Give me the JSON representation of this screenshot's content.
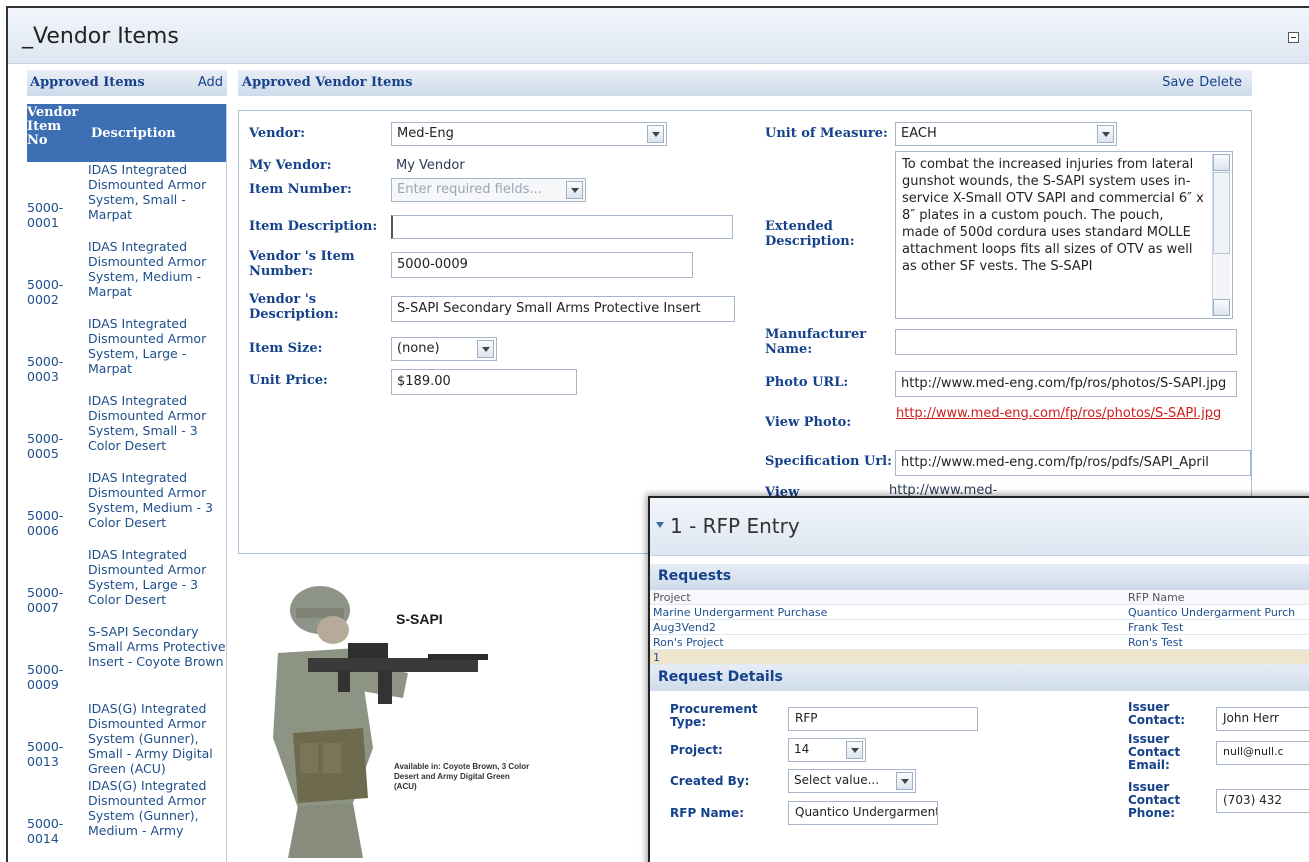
{
  "main": {
    "title": "_Vendor Items"
  },
  "approved_items": {
    "title": "Approved Items",
    "add_label": "Add",
    "col_no": "Vendor Item No",
    "col_desc": "Description",
    "rows": [
      {
        "no": "5000-0001",
        "desc": "IDAS Integrated Dismounted Armor System, Small - Marpat"
      },
      {
        "no": "5000-0002",
        "desc": "IDAS Integrated Dismounted Armor System, Medium - Marpat"
      },
      {
        "no": "5000-0003",
        "desc": "IDAS Integrated Dismounted Armor System, Large - Marpat"
      },
      {
        "no": "5000-0005",
        "desc": "IDAS Integrated Dismounted Armor System, Small - 3 Color Desert"
      },
      {
        "no": "5000-0006",
        "desc": "IDAS Integrated Dismounted Armor System, Medium - 3 Color Desert"
      },
      {
        "no": "5000-0007",
        "desc": "IDAS Integrated Dismounted Armor System, Large - 3 Color Desert"
      },
      {
        "no": "5000-0009",
        "desc": "S-SAPI Secondary Small Arms Protective Insert - Coyote Brown"
      },
      {
        "no": "5000-0013",
        "desc": "IDAS(G) Integrated Dismounted Armor System (Gunner), Small - Army Digital Green (ACU)"
      },
      {
        "no": "5000-0014",
        "desc": "IDAS(G) Integrated Dismounted Armor System (Gunner), Medium - Army"
      }
    ]
  },
  "vendor_items": {
    "title": "Approved Vendor Items",
    "save_label": "Save",
    "delete_label": "Delete",
    "vendor_label": "Vendor:",
    "vendor_value": "Med-Eng",
    "my_vendor_label": "My Vendor:",
    "my_vendor_value": "My Vendor",
    "item_number_label": "Item Number:",
    "item_number_placeholder": "Enter required fields...",
    "item_desc_label": "Item Description:",
    "item_desc_value": "",
    "vendor_item_number_label": "Vendor 's Item Number:",
    "vendor_item_number_value": "5000-0009",
    "vendor_desc_label": "Vendor 's Description:",
    "vendor_desc_value": "S-SAPI Secondary Small Arms Protective Insert",
    "item_size_label": "Item Size:",
    "item_size_value": "(none)",
    "unit_price_label": "Unit Price:",
    "unit_price_value": "$189.00",
    "uom_label": "Unit of Measure:",
    "uom_value": "EACH",
    "ext_desc_label": "Extended Description:",
    "ext_desc_value": "To combat the increased injuries from lateral gunshot wounds, the S-SAPI system uses in-service X-Small OTV SAPI and commercial 6″ x 8″ plates in a custom pouch.  The pouch, made of 500d cordura uses standard MOLLE attachment loops fits all sizes of OTV as well as other SF vests.  The S-SAPI",
    "manufacturer_label": "Manufacturer Name:",
    "manufacturer_value": "",
    "photo_url_label": "Photo URL:",
    "photo_url_value": "http://www.med-eng.com/fp/ros/photos/S-SAPI.jpg",
    "view_photo_label": "View Photo:",
    "view_photo_link": "http://www.med-eng.com/fp/ros/photos/S-SAPI.jpg",
    "spec_url_label": "Specification Url:",
    "spec_url_value": "http://www.med-eng.com/fp/ros/pdfs/SAPI_April",
    "view_label": "View",
    "view_link": "http://www.med-"
  },
  "photo": {
    "title": "S-SAPI",
    "caption": "Available in: Coyote Brown, 3 Color Desert and Army Digital Green (ACU)"
  },
  "rfp": {
    "title": "1 - RFP Entry",
    "requests_title": "Requests",
    "col_project": "Project",
    "col_rfp_name": "RFP Name",
    "rows": [
      {
        "project": "Marine Undergarment Purchase",
        "rfp": "Quantico Undergarment Purch"
      },
      {
        "project": "Aug3Vend2",
        "rfp": "Frank Test"
      },
      {
        "project": "Ron's Project",
        "rfp": "Ron's Test"
      },
      {
        "project": "1",
        "rfp": ""
      }
    ],
    "details_title": "Request Details",
    "procurement_label": "Procurement Type:",
    "procurement_value": "RFP",
    "project_label": "Project:",
    "project_value": "14",
    "created_by_label": "Created By:",
    "created_by_value": "Select value...",
    "rfp_name_label": "RFP Name:",
    "rfp_name_value": "Quantico Undergarment I",
    "issuer_contact_label": "Issuer Contact:",
    "issuer_contact_value": "John Herr",
    "issuer_email_label": "Issuer Contact Email:",
    "issuer_email_value": "null@null.c",
    "issuer_phone_label": "Issuer Contact Phone:",
    "issuer_phone_value": "(703) 432"
  }
}
